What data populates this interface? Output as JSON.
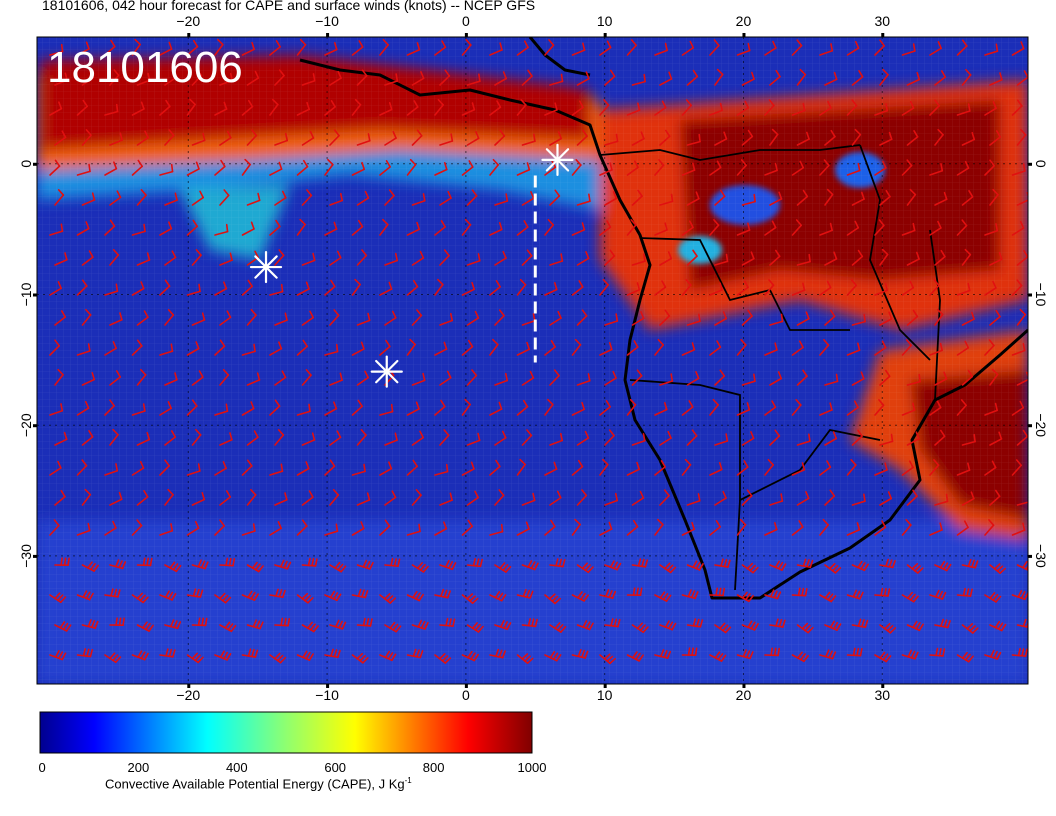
{
  "title": "18101606, 042 hour forecast for CAPE and surface winds (knots) -- NCEP GFS",
  "stamp": "18101606",
  "axes": {
    "lon_ticks": [
      -20,
      -10,
      0,
      10,
      20,
      30
    ],
    "lat_ticks": [
      0,
      -10,
      -20,
      -30
    ],
    "lon_labels": [
      "−20",
      "−10",
      "0",
      "10",
      "20",
      "30"
    ],
    "lat_labels": [
      "0",
      "−10",
      "−20",
      "−30"
    ],
    "lon_range": [
      -30.9,
      40.5
    ],
    "lat_range": [
      -39.8,
      9.7
    ]
  },
  "colorbar": {
    "label": "Convective Available Potential Energy (CAPE), J Kg",
    "label_sup": "-1",
    "ticks": [
      "0",
      "200",
      "400",
      "600",
      "800",
      "1000"
    ],
    "range": [
      0,
      1000
    ]
  },
  "colors": {
    "wind_barb": "#e01010",
    "coastline": "#000000",
    "marker": "#ffffff",
    "ocean_low": "#1b2eb8",
    "cape_high": "#8c0000"
  },
  "markers": [
    {
      "name": "star-marker",
      "lon": -14.4,
      "lat": -7.9
    },
    {
      "name": "star-marker",
      "lon": 6.6,
      "lat": 0.3
    },
    {
      "name": "star-marker",
      "lon": -5.7,
      "lat": -15.9
    }
  ],
  "transect": {
    "lon": 5.0,
    "lat_start": -0.9,
    "lat_end": -15.2
  }
}
